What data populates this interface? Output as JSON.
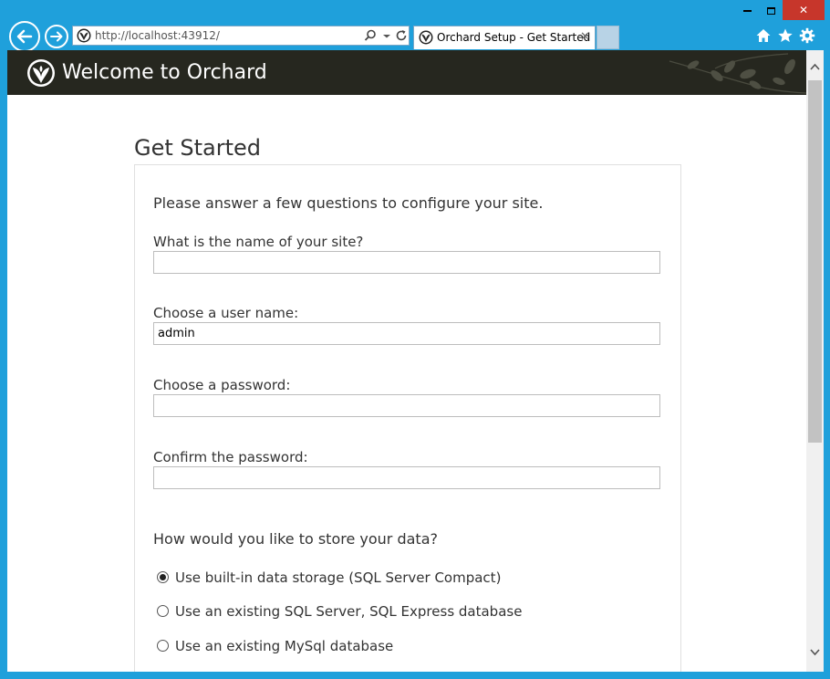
{
  "browser": {
    "address_url": "http://localhost:43912/",
    "tab_title": "Orchard Setup - Get Started",
    "tab_close_glyph": "✕",
    "window_close_glyph": "✕"
  },
  "header": {
    "title": "Welcome to Orchard"
  },
  "page": {
    "title": "Get Started",
    "intro": "Please answer a few questions to configure your site.",
    "fields": {
      "site_name_label": "What is the name of your site?",
      "site_name_value": "",
      "username_label": "Choose a user name:",
      "username_value": "admin",
      "password_label": "Choose a password:",
      "password_value": "",
      "confirm_label": "Confirm the password:",
      "confirm_value": ""
    },
    "storage": {
      "question": "How would you like to store your data?",
      "options": [
        {
          "label": "Use built-in data storage (SQL Server Compact)",
          "checked": true
        },
        {
          "label": "Use an existing SQL Server, SQL Express database",
          "checked": false
        },
        {
          "label": "Use an existing MySql database",
          "checked": false
        }
      ]
    }
  },
  "colors": {
    "window_frame": "#1fa0db",
    "header_bg": "#26271f",
    "close_button": "#c7362b"
  },
  "icons": [
    "back-arrow-icon",
    "forward-arrow-icon",
    "orchard-favicon-icon",
    "search-icon",
    "dropdown-icon",
    "refresh-icon",
    "home-icon",
    "star-icon",
    "gear-icon",
    "orchard-logo-icon"
  ]
}
